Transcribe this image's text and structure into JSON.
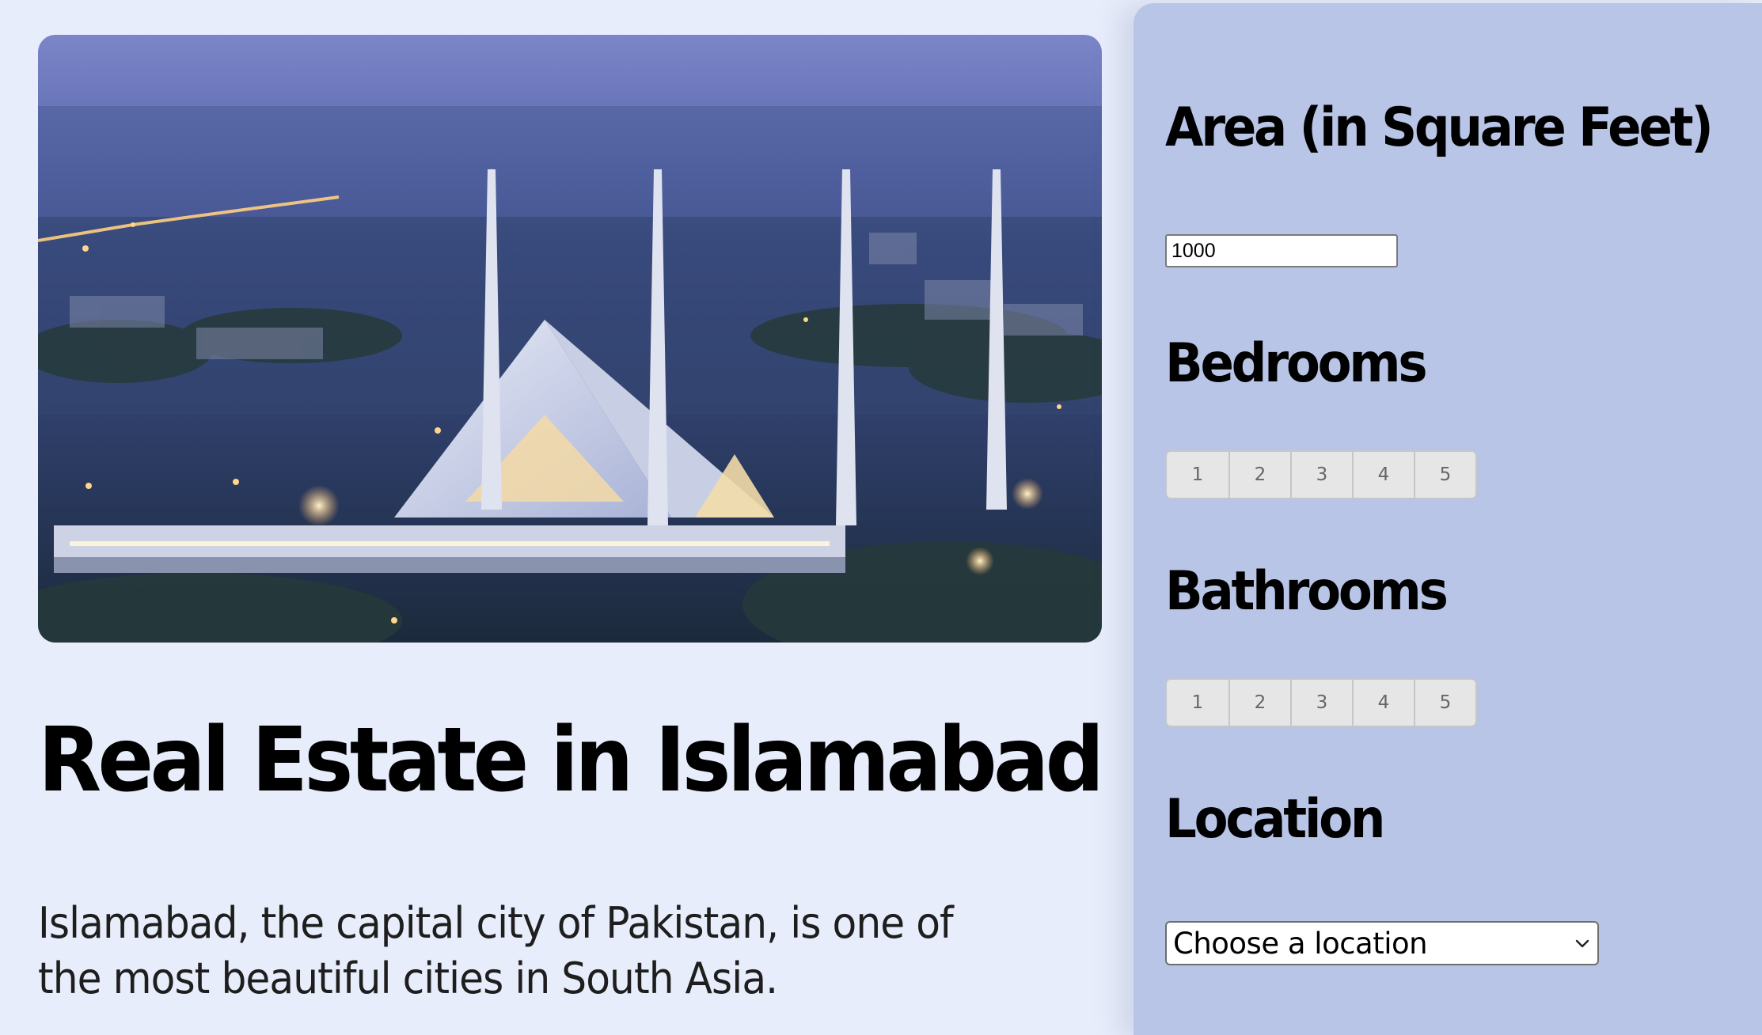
{
  "hero": {
    "image_icon": "mosque-city-night-photo",
    "sky_top": "#7b86c8",
    "sky_bottom": "#5a69b0"
  },
  "main": {
    "title": "Real Estate in Islamabad",
    "description": "Islamabad, the capital city of Pakistan, is one of the most beautiful cities in South Asia."
  },
  "form": {
    "area": {
      "label": "Area (in Square Feet)",
      "value": "1000"
    },
    "bedrooms": {
      "label": "Bedrooms",
      "options": [
        "1",
        "2",
        "3",
        "4",
        "5"
      ]
    },
    "bathrooms": {
      "label": "Bathrooms",
      "options": [
        "1",
        "2",
        "3",
        "4",
        "5"
      ]
    },
    "location": {
      "label": "Location",
      "selected": "Choose a location",
      "icon": "chevron-down-icon"
    }
  },
  "colors": {
    "page_background": "#e8edfb",
    "panel_background": "#b8c5e6",
    "segment_button": "#e6e6e6"
  }
}
